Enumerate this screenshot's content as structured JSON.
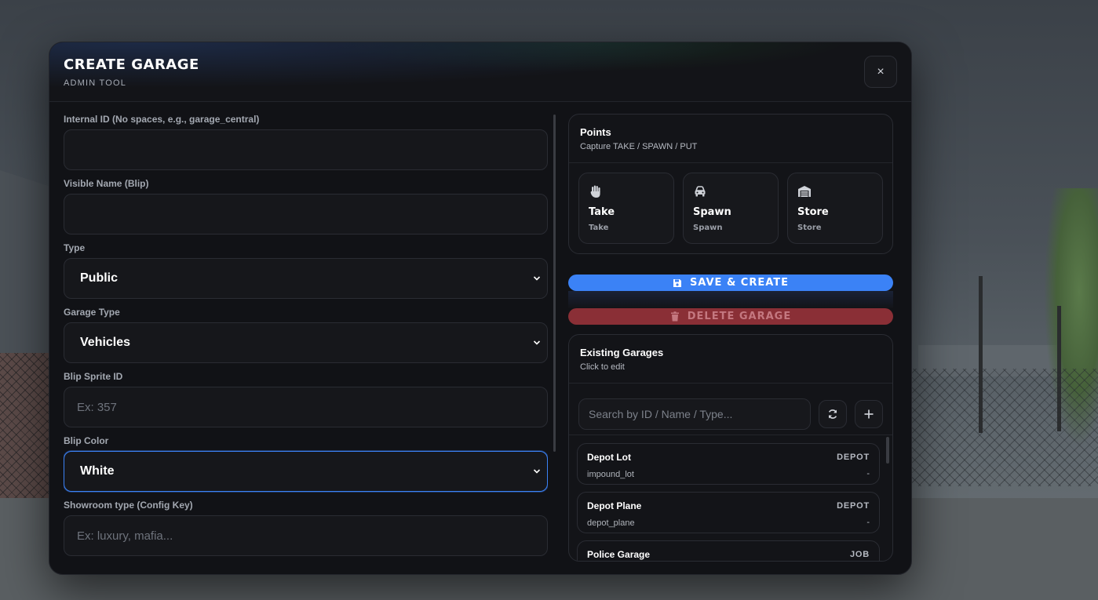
{
  "header": {
    "title": "CREATE GARAGE",
    "subtitle": "ADMIN TOOL",
    "close_label": "×"
  },
  "form": {
    "internal_id": {
      "label": "Internal ID (No spaces, e.g., garage_central)",
      "value": ""
    },
    "visible_name": {
      "label": "Visible Name (Blip)",
      "value": ""
    },
    "type": {
      "label": "Type",
      "value": "Public"
    },
    "garage_type": {
      "label": "Garage Type",
      "value": "Vehicles"
    },
    "blip_sprite": {
      "label": "Blip Sprite ID",
      "placeholder": "Ex: 357"
    },
    "blip_color": {
      "label": "Blip Color",
      "value": "White"
    },
    "showroom_type": {
      "label": "Showroom type (Config Key)",
      "placeholder": "Ex: luxury, mafia..."
    }
  },
  "points": {
    "title": "Points",
    "subtitle": "Capture TAKE / SPAWN / PUT",
    "cards": [
      {
        "name": "Take",
        "key": "Take",
        "icon": "hand-icon"
      },
      {
        "name": "Spawn",
        "key": "Spawn",
        "icon": "car-icon"
      },
      {
        "name": "Store",
        "key": "Store",
        "icon": "warehouse-icon"
      }
    ]
  },
  "actions": {
    "save_label": "SAVE & CREATE",
    "delete_label": "DELETE GARAGE"
  },
  "garages": {
    "title": "Existing Garages",
    "subtitle": "Click to edit",
    "search_placeholder": "Search by ID / Name / Type...",
    "items": [
      {
        "name": "Depot Lot",
        "id": "impound_lot",
        "type": "DEPOT",
        "extra": "-"
      },
      {
        "name": "Depot Plane",
        "id": "depot_plane",
        "type": "DEPOT",
        "extra": "-"
      },
      {
        "name": "Police Garage",
        "id": "",
        "type": "JOB",
        "extra": ""
      }
    ]
  },
  "colors": {
    "accent": "#3b82f6",
    "danger": "#8a2f36",
    "modal_bg": "#111216"
  }
}
